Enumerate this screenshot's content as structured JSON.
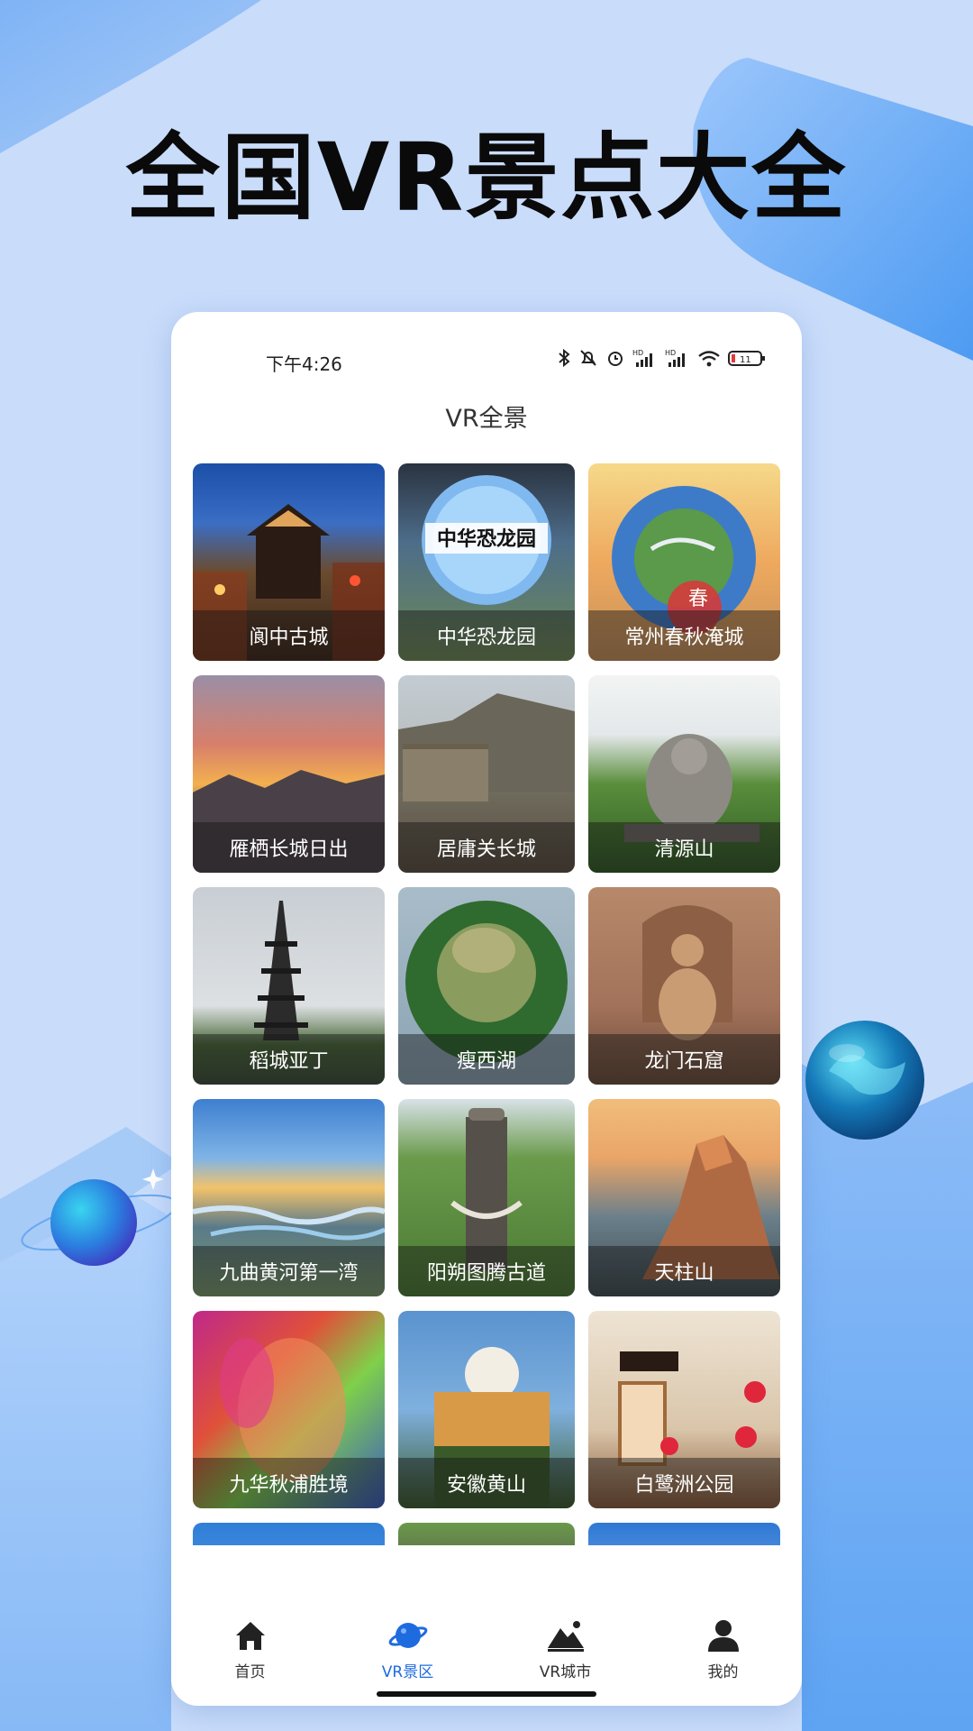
{
  "hero": {
    "title": "全国VR景点大全"
  },
  "status_bar": {
    "time": "下午4:26",
    "battery": "11"
  },
  "app": {
    "title": "VR全景"
  },
  "scenic_spots": [
    {
      "name": "阆中古城"
    },
    {
      "name": "中华恐龙园"
    },
    {
      "name": "常州春秋淹城"
    },
    {
      "name": "雁栖长城日出"
    },
    {
      "name": "居庸关长城"
    },
    {
      "name": "清源山"
    },
    {
      "name": "稻城亚丁"
    },
    {
      "name": "瘦西湖"
    },
    {
      "name": "龙门石窟"
    },
    {
      "name": "九曲黄河第一湾"
    },
    {
      "name": "阳朔图腾古道"
    },
    {
      "name": "天柱山"
    },
    {
      "name": "九华秋浦胜境"
    },
    {
      "name": "安徽黄山"
    },
    {
      "name": "白鹭洲公园"
    },
    {
      "name": ""
    },
    {
      "name": ""
    },
    {
      "name": ""
    }
  ],
  "tabs": [
    {
      "label": "首页",
      "icon": "home-icon"
    },
    {
      "label": "VR景区",
      "icon": "planet-icon",
      "active": true
    },
    {
      "label": "VR城市",
      "icon": "mountain-icon"
    },
    {
      "label": "我的",
      "icon": "user-icon"
    }
  ],
  "colors": {
    "accent": "#1e6be0",
    "background": "#c9dcfa"
  }
}
